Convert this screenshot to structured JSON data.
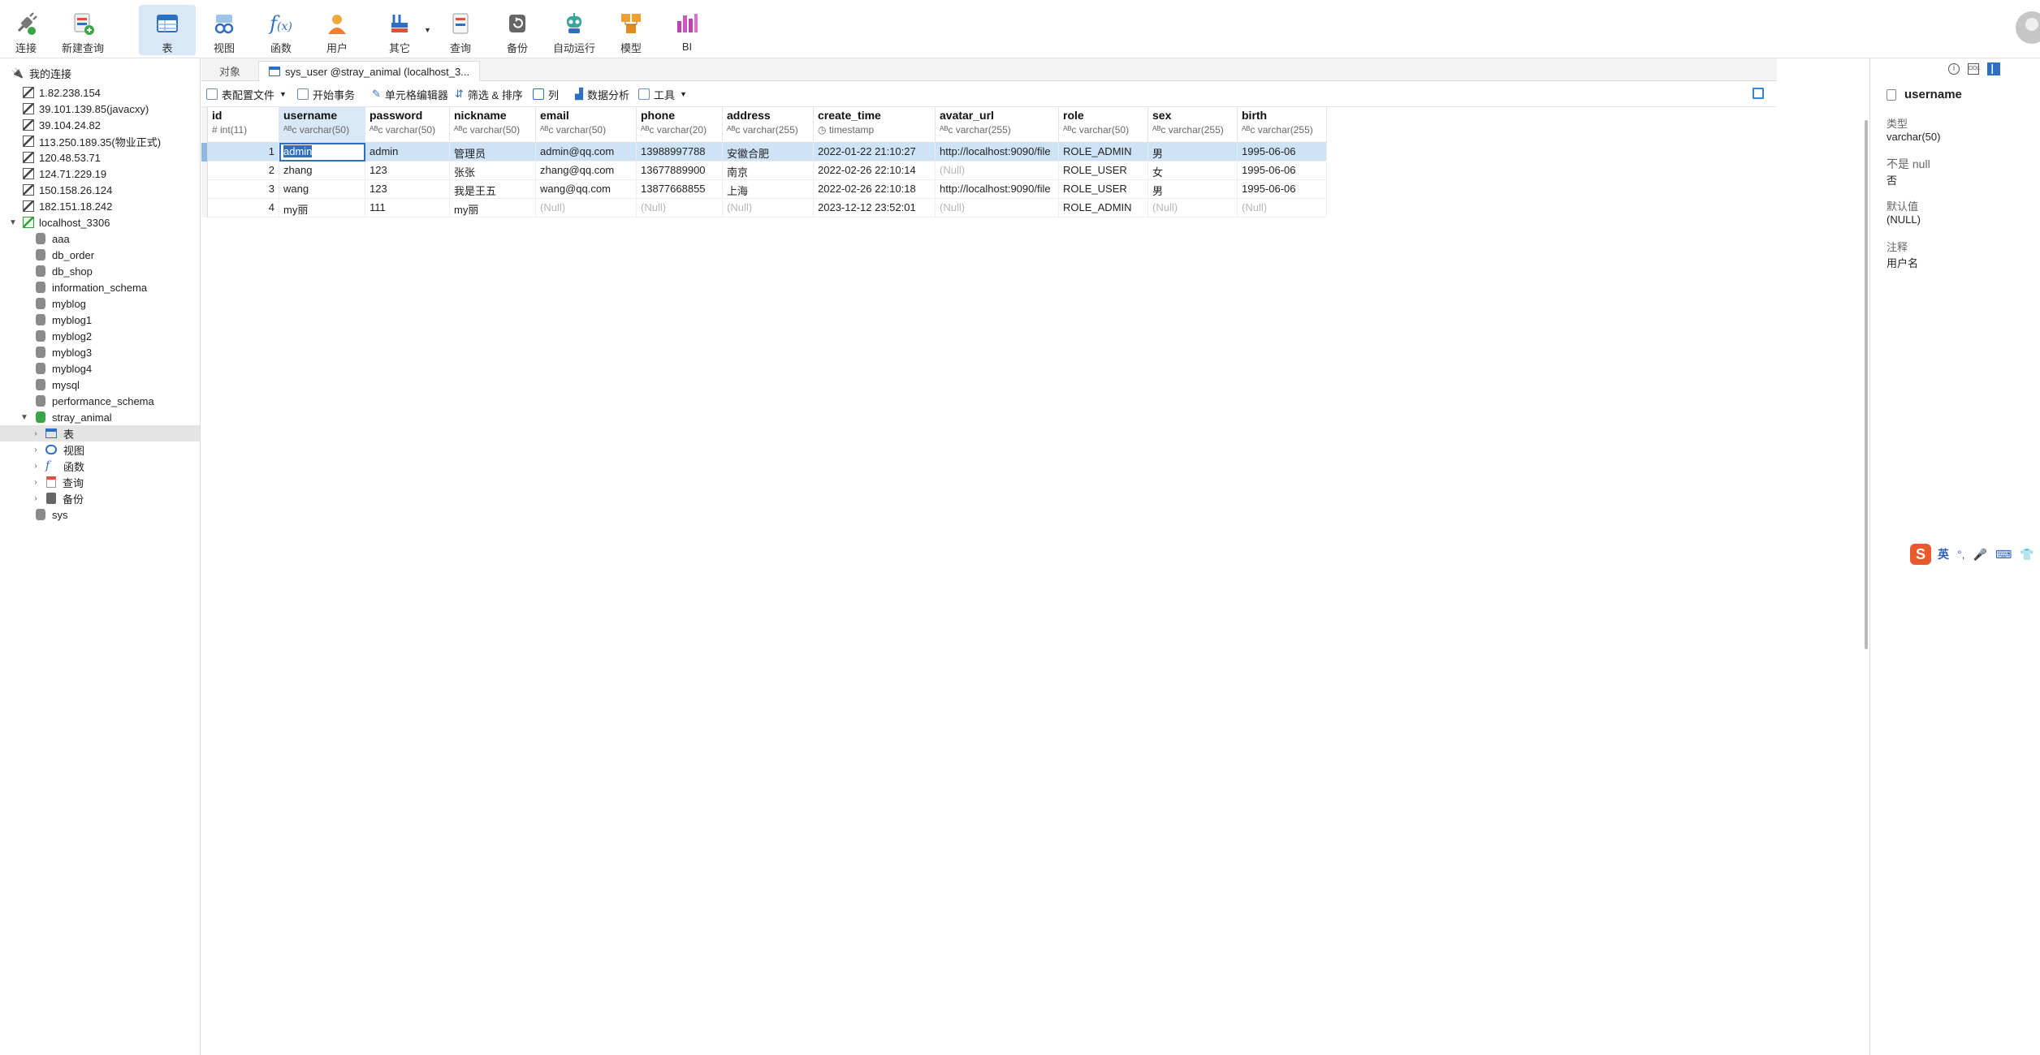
{
  "toolbar": {
    "items": [
      {
        "label": "连接",
        "icon": "plug-icon"
      },
      {
        "label": "新建查询",
        "icon": "new-query-icon"
      },
      {
        "label": "表",
        "icon": "table-icon"
      },
      {
        "label": "视图",
        "icon": "view-icon"
      },
      {
        "label": "函数",
        "icon": "function-icon"
      },
      {
        "label": "用户",
        "icon": "user-icon"
      },
      {
        "label": "其它",
        "icon": "other-icon"
      },
      {
        "label": "查询",
        "icon": "query-icon"
      },
      {
        "label": "备份",
        "icon": "backup-icon"
      },
      {
        "label": "自动运行",
        "icon": "robot-icon"
      },
      {
        "label": "模型",
        "icon": "model-icon"
      },
      {
        "label": "BI",
        "icon": "bi-icon"
      }
    ],
    "active": "表"
  },
  "sidebar": {
    "root": "我的连接",
    "connections": [
      "1.82.238.154",
      "39.101.139.85(javacxy)",
      "39.104.24.82",
      "113.250.189.35(物业正式)",
      "120.48.53.71",
      "124.71.229.19",
      "150.158.26.124",
      "182.151.18.242"
    ],
    "open_connection": "localhost_3306",
    "databases": [
      "aaa",
      "db_order",
      "db_shop",
      "information_schema",
      "myblog",
      "myblog1",
      "myblog2",
      "myblog3",
      "myblog4",
      "mysql",
      "performance_schema"
    ],
    "open_db": "stray_animal",
    "db_children": [
      "表",
      "视图",
      "函数",
      "查询",
      "备份"
    ],
    "last_db": "sys"
  },
  "tabs": {
    "objects": "对象",
    "active": "sys_user @stray_animal (localhost_3..."
  },
  "subtoolbar": {
    "config": "表配置文件",
    "begin_tx": "开始事务",
    "cell_editor": "单元格编辑器",
    "filter_sort": "筛选 & 排序",
    "columns": "列",
    "analysis": "数据分析",
    "tools": "工具"
  },
  "grid": {
    "columns": [
      {
        "name": "id",
        "type": "int(11)"
      },
      {
        "name": "username",
        "type": "varchar(50)"
      },
      {
        "name": "password",
        "type": "varchar(50)"
      },
      {
        "name": "nickname",
        "type": "varchar(50)"
      },
      {
        "name": "email",
        "type": "varchar(50)"
      },
      {
        "name": "phone",
        "type": "varchar(20)"
      },
      {
        "name": "address",
        "type": "varchar(255)"
      },
      {
        "name": "create_time",
        "type": "timestamp"
      },
      {
        "name": "avatar_url",
        "type": "varchar(255)"
      },
      {
        "name": "role",
        "type": "varchar(50)"
      },
      {
        "name": "sex",
        "type": "varchar(255)"
      },
      {
        "name": "birth",
        "type": "varchar(255)"
      }
    ],
    "rows": [
      [
        "1",
        "admin",
        "admin",
        "管理员",
        "admin@qq.com",
        "13988997788",
        "安徽合肥",
        "2022-01-22 21:10:27",
        "http://localhost:9090/file",
        "ROLE_ADMIN",
        "男",
        "1995-06-06"
      ],
      [
        "2",
        "zhang",
        "123",
        "张张",
        "zhang@qq.com",
        "13677889900",
        "南京",
        "2022-02-26 22:10:14",
        "(Null)",
        "ROLE_USER",
        "女",
        "1995-06-06"
      ],
      [
        "3",
        "wang",
        "123",
        "我是王五",
        "wang@qq.com",
        "13877668855",
        "上海",
        "2022-02-26 22:10:18",
        "http://localhost:9090/file",
        "ROLE_USER",
        "男",
        "1995-06-06"
      ],
      [
        "4",
        "my丽",
        "111",
        "my丽",
        "(Null)",
        "(Null)",
        "(Null)",
        "2023-12-12 23:52:01",
        "(Null)",
        "ROLE_ADMIN",
        "(Null)",
        "(Null)"
      ]
    ]
  },
  "rightpanel": {
    "field": "username",
    "type_label": "类型",
    "type_value": "varchar(50)",
    "notnull_label": "不是 null",
    "notnull_value": "否",
    "default_label": "默认值",
    "default_value": "(NULL)",
    "comment_label": "注释",
    "comment_value": "用户名"
  },
  "ime": {
    "mode": "英"
  }
}
